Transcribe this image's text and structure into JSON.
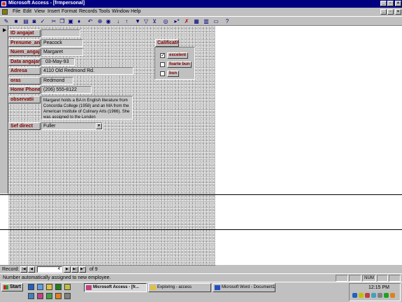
{
  "window": {
    "title": "Microsoft Access - [frmpersonal]"
  },
  "menu": [
    "File",
    "Edit",
    "View",
    "Insert",
    "Format",
    "Records",
    "Tools",
    "Window",
    "Help"
  ],
  "toolbar": {
    "icons": [
      "design-view-icon",
      "save-icon",
      "print-icon",
      "print-preview-icon",
      "spelling-icon",
      "cut-icon",
      "copy-icon",
      "paste-icon",
      "format-painter-icon",
      "undo-icon",
      "hyperlink-icon",
      "web-toolbar-icon",
      "sort-ascending-icon",
      "sort-descending-icon",
      "filter-by-selection-icon",
      "filter-by-form-icon",
      "apply-filter-icon",
      "find-icon",
      "new-record-icon",
      "delete-record-icon",
      "properties-icon",
      "database-window-icon",
      "new-object-icon",
      "help-icon"
    ]
  },
  "form": {
    "fields": [
      {
        "label": "ID angajat",
        "value": ""
      },
      {
        "label": "Prenume_ang",
        "value": "Peacock"
      },
      {
        "label": "Nuem_angajat",
        "value": "Margaret"
      },
      {
        "label": "Data angajarii",
        "value": "03-May-93"
      },
      {
        "label": "Adresa",
        "value": "4110 Old Redmond Rd."
      },
      {
        "label": "oras",
        "value": "Redmond"
      },
      {
        "label": "Home Phone",
        "value": "(206) 555-8122"
      }
    ],
    "observatii": {
      "label": "observatii",
      "value": "Margaret holds a BA in English literature from Concordia College (1958) and an MA from the American Institute of Culinary Arts (1966).  She was assigned to the London"
    },
    "sef_direct": {
      "label": "Sef direct",
      "value": "Fuller"
    },
    "calificativ": {
      "label": "Calificativ",
      "options": [
        {
          "label": "excelent",
          "checked": true
        },
        {
          "label": "foarte bun",
          "checked": false
        },
        {
          "label": "bun",
          "checked": false
        }
      ]
    }
  },
  "navigator": {
    "record_label": "Record:",
    "current": "4",
    "of_text": "of  9"
  },
  "statusbar": {
    "text": "Number automatically assigned to new employee.",
    "num": "NUM"
  },
  "taskbar": {
    "start_label": "Start",
    "tasks": [
      {
        "label": "Microsoft Access - [fr...",
        "active": true
      },
      {
        "label": "Exploring - access",
        "active": false
      },
      {
        "label": "Microsoft Word - Document1",
        "active": false
      }
    ],
    "clock": "12:15 PM"
  }
}
